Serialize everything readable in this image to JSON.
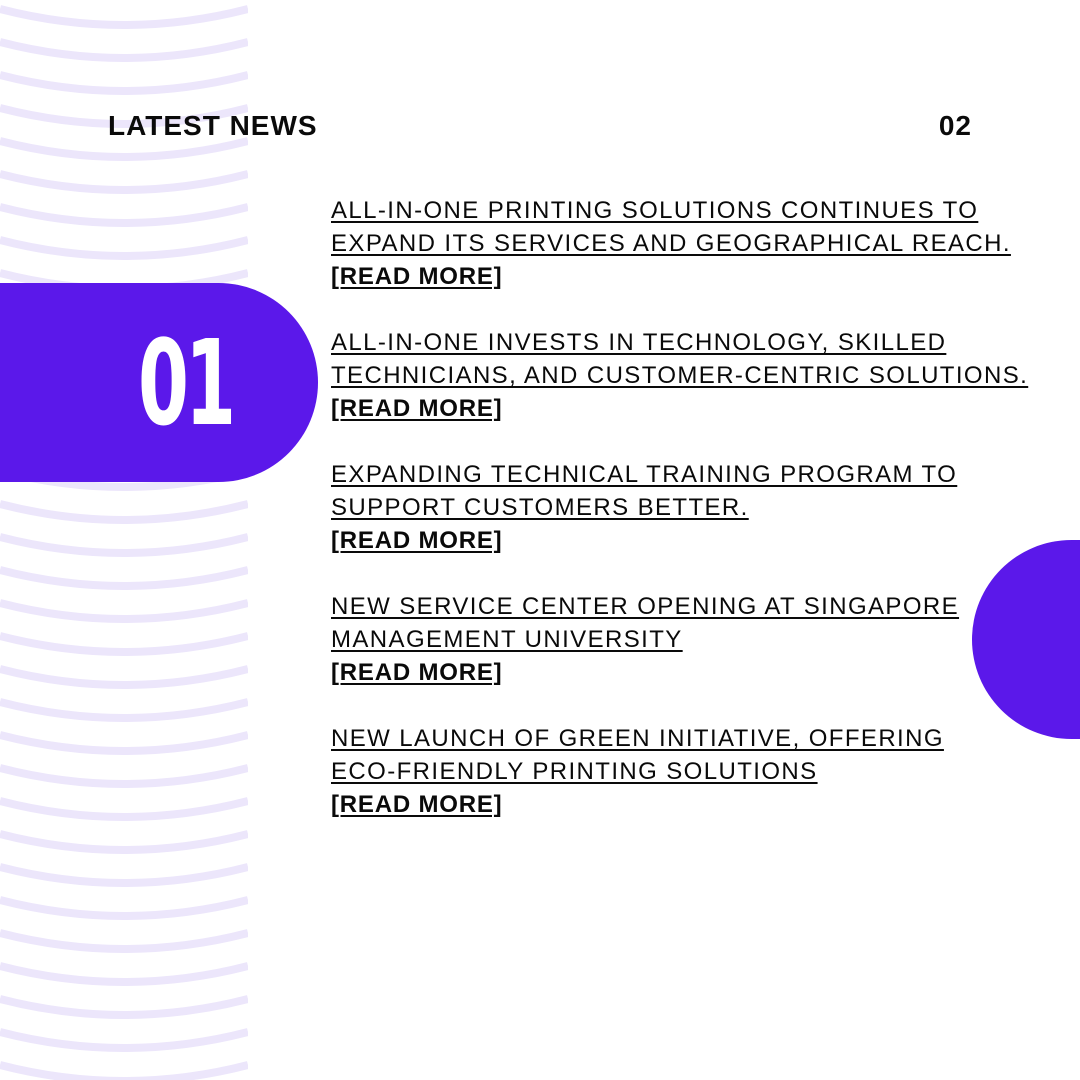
{
  "header": {
    "title": "LATEST NEWS",
    "page_number": "02"
  },
  "badge": {
    "number": "01"
  },
  "news": [
    {
      "line1": "ALL-IN-ONE PRINTING SOLUTIONS CONTINUES TO",
      "line2": "EXPAND ITS SERVICES AND GEOGRAPHICAL REACH.",
      "link": "[READ MORE]"
    },
    {
      "line1": "ALL-IN-ONE INVESTS IN TECHNOLOGY, SKILLED",
      "line2": "TECHNICIANS, AND CUSTOMER-CENTRIC SOLUTIONS.",
      "link": "[READ MORE]"
    },
    {
      "line1": "EXPANDING TECHNICAL TRAINING PROGRAM TO",
      "line2": "SUPPORT CUSTOMERS BETTER.",
      "link": "[READ MORE]"
    },
    {
      "line1": "NEW SERVICE CENTER OPENING AT SINGAPORE",
      "line2": "MANAGEMENT UNIVERSITY",
      "link": "[READ MORE]"
    },
    {
      "line1": "NEW LAUNCH OF GREEN INITIATIVE, OFFERING",
      "line2": "ECO-FRIENDLY PRINTING SOLUTIONS",
      "link": "[READ MORE]"
    }
  ],
  "colors": {
    "accent": "#5b18ea",
    "wave": "#ece6fb",
    "text": "#0a0a0a",
    "background": "#ffffff"
  }
}
